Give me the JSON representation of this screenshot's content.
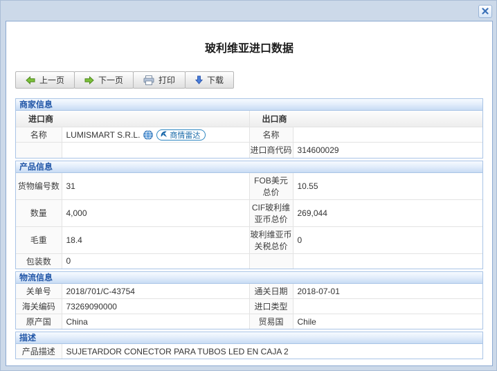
{
  "page": {
    "title": "玻利维亚进口数据"
  },
  "window": {
    "close_icon": "x-icon"
  },
  "toolbar": {
    "prev_label": "上一页",
    "next_label": "下一页",
    "print_label": "打印",
    "download_label": "下载"
  },
  "merchant": {
    "header": "商家信息",
    "importer_header": "进口商",
    "exporter_header": "出口商",
    "name_label": "名称",
    "importer_name": "LUMISMART S.R.L.",
    "radar_badge": "商情雷达",
    "exporter_name_label": "名称",
    "exporter_name": "",
    "importer_code_label": "进口商代码",
    "importer_code": "314600029"
  },
  "product": {
    "header": "产品信息",
    "rows": [
      {
        "l1": "货物编号数",
        "v1": "31",
        "l2": "FOB美元总价",
        "v2": "10.55"
      },
      {
        "l1": "数量",
        "v1": "4,000",
        "l2": "CIF玻利维亚币总价",
        "v2": "269,044"
      },
      {
        "l1": "毛重",
        "v1": "18.4",
        "l2": "玻利维亚币关税总价",
        "v2": "0"
      },
      {
        "l1": "包装数",
        "v1": "0",
        "l2": "",
        "v2": ""
      }
    ]
  },
  "logistics": {
    "header": "物流信息",
    "rows": [
      {
        "l1": "关单号",
        "v1": "2018/701/C-43754",
        "l2": "通关日期",
        "v2": "2018-07-01"
      },
      {
        "l1": "海关编码",
        "v1": "73269090000",
        "l2": "进口类型",
        "v2": ""
      },
      {
        "l1": "原产国",
        "v1": "China",
        "l2": "贸易国",
        "v2": "Chile"
      }
    ]
  },
  "description": {
    "header": "描述",
    "label": "产品描述",
    "value": "SUJETARDOR CONECTOR PARA TUBOS LED EN CAJA 2"
  },
  "colors": {
    "frame": "#ccd9e9",
    "panel_border": "#8ca9d1",
    "section_border": "#a9c4e6",
    "section_header_text": "#2257a8",
    "green_arrow": "#7cc03a",
    "download_arrow": "#4a7ed9",
    "radar_blue": "#1769a8"
  }
}
